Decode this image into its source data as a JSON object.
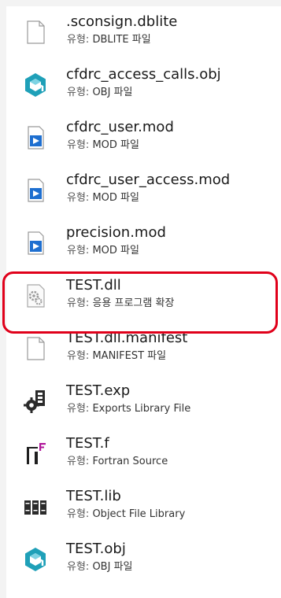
{
  "type_label": "유형:",
  "files": [
    {
      "name": ".sconsign.dblite",
      "type": "DBLITE 파일",
      "icon": "blank-file-icon"
    },
    {
      "name": "cfdrc_access_calls.obj",
      "type": "OBJ 파일",
      "icon": "obj-3d-icon"
    },
    {
      "name": "cfdrc_user.mod",
      "type": "MOD 파일",
      "icon": "mod-file-icon"
    },
    {
      "name": "cfdrc_user_access.mod",
      "type": "MOD 파일",
      "icon": "mod-file-icon"
    },
    {
      "name": "precision.mod",
      "type": "MOD 파일",
      "icon": "mod-file-icon"
    },
    {
      "name": "TEST.dll",
      "type": "응용 프로그램 확장",
      "icon": "dll-gear-file-icon"
    },
    {
      "name": "TEST.dll.manifest",
      "type": "MANIFEST 파일",
      "icon": "blank-file-icon"
    },
    {
      "name": "TEST.exp",
      "type": "Exports Library File",
      "icon": "exp-gear-icon"
    },
    {
      "name": "TEST.f",
      "type": "Fortran Source",
      "icon": "fortran-file-icon"
    },
    {
      "name": "TEST.lib",
      "type": "Object File Library",
      "icon": "library-books-icon"
    },
    {
      "name": "TEST.obj",
      "type": "OBJ 파일",
      "icon": "obj-3d-icon"
    }
  ],
  "highlighted_item": "TEST.dll",
  "colors": {
    "highlight_border": "#e0001a",
    "obj_icon": "#1fa0b8",
    "mod_icon": "#1e6fd0",
    "fortran_accent": "#b0169a"
  }
}
